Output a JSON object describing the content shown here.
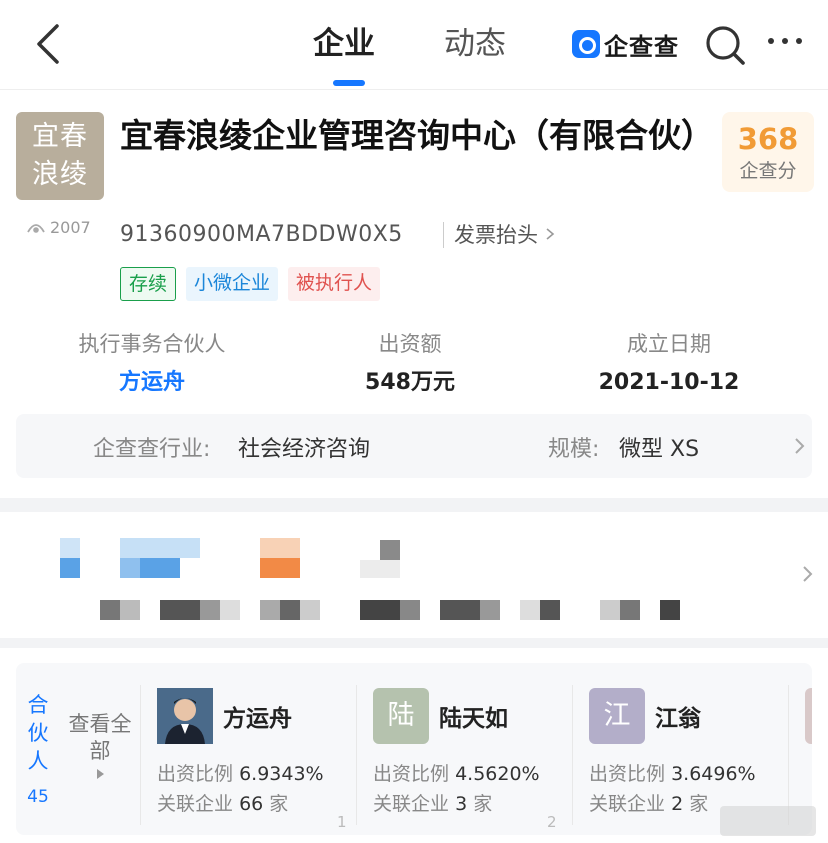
{
  "nav": {
    "tabs": [
      {
        "label": "企业",
        "active": true
      },
      {
        "label": "动态",
        "active": false
      }
    ],
    "brand": "企查查",
    "accent": "#1677ff"
  },
  "company": {
    "logo_text_line1": "宜春",
    "logo_text_line2": "浪绫",
    "name": "宜春浪绫企业管理咨询中心（有限合伙）",
    "view_count": "2007",
    "credit_code": "91360900MA7BDDW0X5",
    "invoice_label": "发票抬头",
    "score": "368",
    "score_label": "企查分",
    "tags": [
      {
        "label": "存续",
        "color": "#1a9f4b"
      },
      {
        "label": "小微企业",
        "color": "#1b86d9"
      },
      {
        "label": "被执行人",
        "color": "#e0524f"
      }
    ]
  },
  "stats": [
    {
      "label": "执行事务合伙人",
      "value": "方运舟"
    },
    {
      "label": "出资额",
      "value": "548万元"
    },
    {
      "label": "成立日期",
      "value": "2021-10-12"
    }
  ],
  "industry": {
    "label": "企查查行业:",
    "value": "社会经济咨询",
    "scale_label": "规模:",
    "scale_value": "微型 XS"
  },
  "partners": {
    "section_label": "合伙人",
    "count": "45",
    "view_all": "查看全部",
    "items": [
      {
        "name": "方运舟",
        "avatar_char": "",
        "avatar_color": "#3b5a7a",
        "ratio_label": "出资比例",
        "ratio": "6.9343%",
        "related_label": "关联企业",
        "related": "66",
        "related_unit": "家",
        "index": "1"
      },
      {
        "name": "陆天如",
        "avatar_char": "陆",
        "avatar_color": "#b5c2ae",
        "ratio_label": "出资比例",
        "ratio": "4.5620%",
        "related_label": "关联企业",
        "related": "3",
        "related_unit": "家",
        "index": "2"
      },
      {
        "name": "江翁",
        "avatar_char": "江",
        "avatar_color": "#b3aec9",
        "ratio_label": "出资比例",
        "ratio": "3.6496%",
        "related_label": "关联企业",
        "related": "2",
        "related_unit": "家",
        "index": ""
      }
    ]
  }
}
